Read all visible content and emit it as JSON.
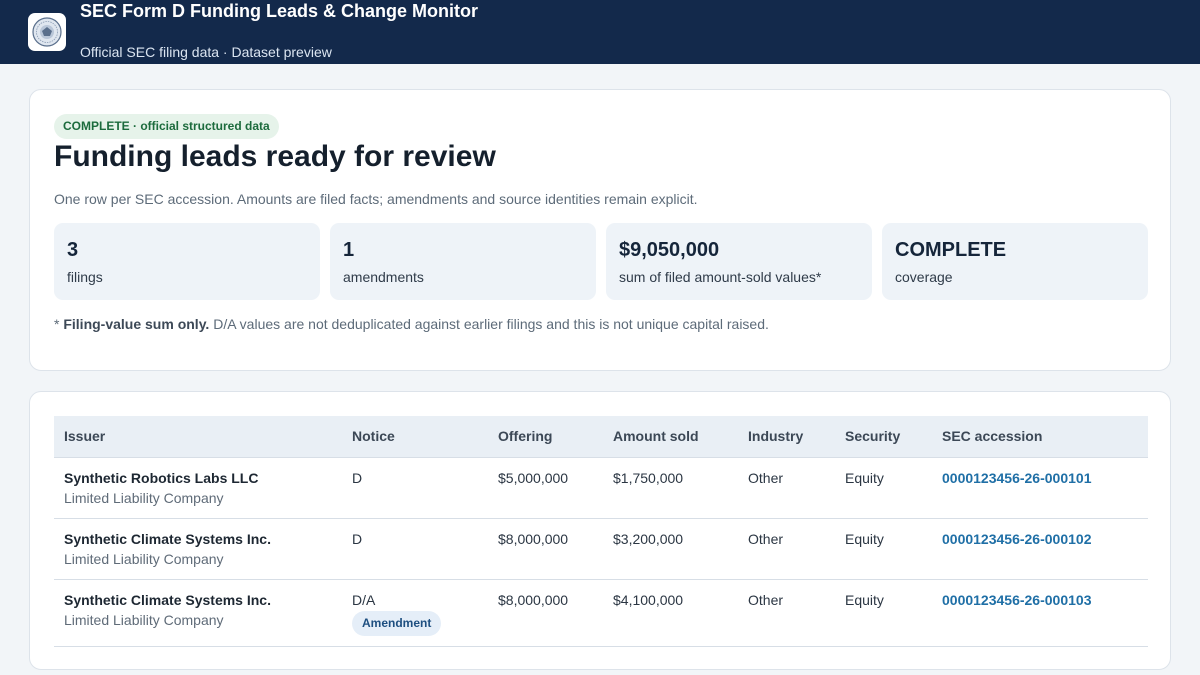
{
  "header": {
    "title": "SEC Form D Funding Leads & Change Monitor",
    "subtitle": "Official SEC filing data · Dataset preview",
    "logo_icon": "sec-seal-icon"
  },
  "summary": {
    "status_pill": "COMPLETE · official structured data",
    "headline": "Funding leads ready for review",
    "lede": "One row per SEC accession. Amounts are filed facts; amendments and source identities remain explicit.",
    "stats": [
      {
        "value": "3",
        "label": "filings"
      },
      {
        "value": "1",
        "label": "amendments"
      },
      {
        "value": "$9,050,000",
        "label": "sum of filed amount-sold values*"
      },
      {
        "value": "COMPLETE",
        "label": "coverage"
      }
    ],
    "footnote_prefix": "* ",
    "footnote_bold": "Filing-value sum only.",
    "footnote_text": " D/A values are not deduplicated against earlier filings and this is not unique capital raised."
  },
  "table": {
    "columns": [
      "Issuer",
      "Notice",
      "Offering",
      "Amount sold",
      "Industry",
      "Security",
      "SEC accession"
    ],
    "rows": [
      {
        "issuer": "Synthetic Robotics Labs LLC",
        "issuer_type": "Limited Liability Company",
        "notice": "D",
        "badge": "",
        "offering": "$5,000,000",
        "amount_sold": "$1,750,000",
        "industry": "Other",
        "security": "Equity",
        "accession": "0000123456-26-000101"
      },
      {
        "issuer": "Synthetic Climate Systems Inc.",
        "issuer_type": "Limited Liability Company",
        "notice": "D",
        "badge": "",
        "offering": "$8,000,000",
        "amount_sold": "$3,200,000",
        "industry": "Other",
        "security": "Equity",
        "accession": "0000123456-26-000102"
      },
      {
        "issuer": "Synthetic Climate Systems Inc.",
        "issuer_type": "Limited Liability Company",
        "notice": "D/A",
        "badge": "Amendment",
        "offering": "$8,000,000",
        "amount_sold": "$4,100,000",
        "industry": "Other",
        "security": "Equity",
        "accession": "0000123456-26-000103"
      }
    ]
  },
  "colors": {
    "header_bg": "#13294b",
    "accent_link": "#1f6fa6",
    "complete_pill_bg": "#e6f3ea",
    "complete_pill_text": "#1c6b3d"
  }
}
